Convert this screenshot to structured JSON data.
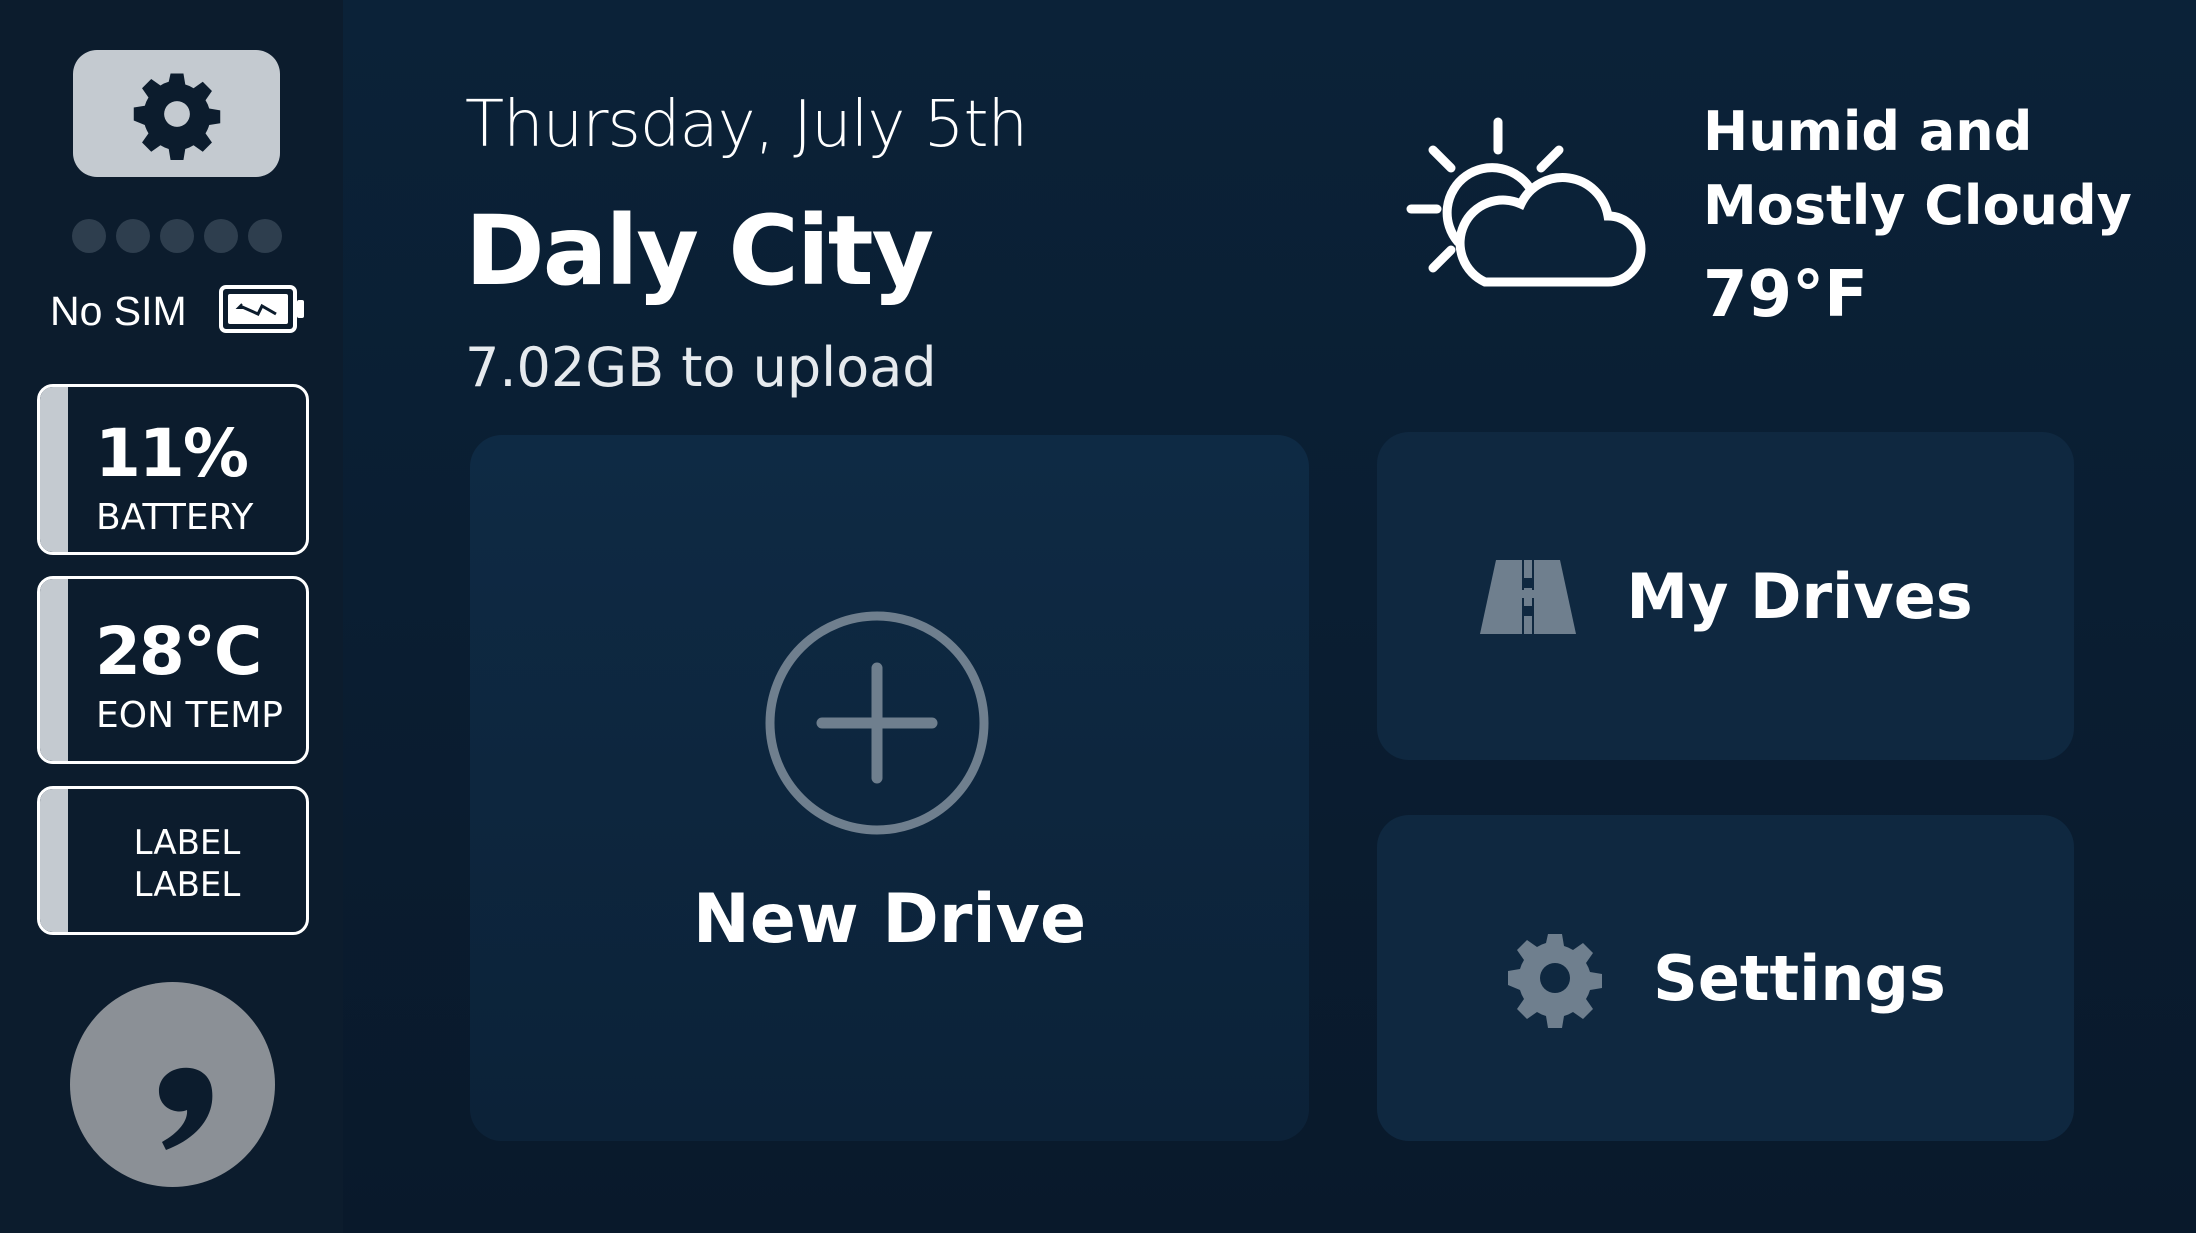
{
  "sidebar": {
    "settings_icon": "gear-icon",
    "signal_bars_total": 5,
    "signal_bars_active": 0,
    "sim_status": "No SIM",
    "battery_icon": "battery-charging-icon",
    "metrics": [
      {
        "value": "11%",
        "label": "BATTERY"
      },
      {
        "value": "28°C",
        "label": "EON TEMP"
      },
      {
        "line1": "LABEL",
        "line2": "LABEL"
      }
    ],
    "logo": "comma-logo-icon"
  },
  "header": {
    "date": "Thursday, July 5th",
    "city": "Daly City",
    "upload": "7.02GB to upload"
  },
  "weather": {
    "icon": "partly-cloudy-icon",
    "condition_line1": "Humid and",
    "condition_line2": "Mostly Cloudy",
    "temperature": "79°F"
  },
  "tiles": {
    "new_drive": {
      "icon": "plus-circle-icon",
      "label": "New Drive"
    },
    "my_drives": {
      "icon": "road-icon",
      "label": "My Drives"
    },
    "settings": {
      "icon": "gear-icon",
      "label": "Settings"
    }
  },
  "colors": {
    "background": "#0a1f35",
    "sidebar": "#0c1c2d",
    "tile": "#0f2840",
    "accent_gray": "#c4cad0",
    "icon_gray": "#6f7f8e"
  }
}
